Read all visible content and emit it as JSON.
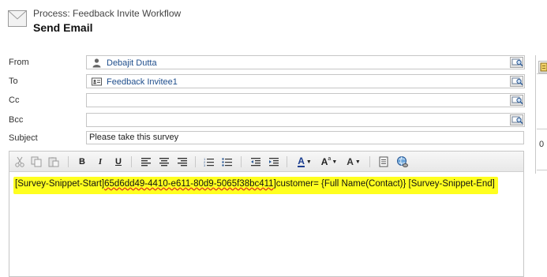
{
  "header": {
    "process": "Process: Feedback Invite Workflow",
    "title": "Send Email"
  },
  "form": {
    "from": {
      "label": "From",
      "value": "Debajit Dutta"
    },
    "to": {
      "label": "To",
      "value": "Feedback Invitee1"
    },
    "cc": {
      "label": "Cc",
      "value": ""
    },
    "bcc": {
      "label": "Bcc",
      "value": ""
    },
    "subject": {
      "label": "Subject",
      "value": "Please take this survey"
    }
  },
  "toolbar": {
    "bold": "B",
    "italic": "I",
    "underline": "U",
    "font_color": "A",
    "font_size": "A",
    "highlight": "A"
  },
  "editor": {
    "body_part1": "[Survey-Snippet-Start]",
    "body_id": "65d6dd49-4410-e611-80d9-5065f38bc411",
    "body_part2": "]customer= {Full Name(Contact)} [Survey-Snippet-End]"
  },
  "side": {
    "count": "0"
  },
  "colors": {
    "highlight": "#ffff1f",
    "link": "#1f4e8c"
  }
}
